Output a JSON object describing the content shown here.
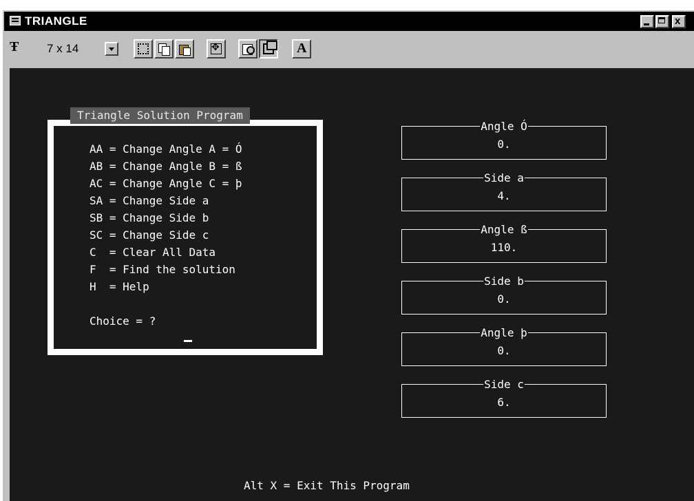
{
  "window": {
    "title": "TRIANGLE",
    "close_label": "x"
  },
  "toolbar": {
    "font_size": "7 x 14",
    "font_icon": "Ŧ",
    "font_button": "A",
    "icons": [
      "font-type-icon",
      "mark-icon",
      "copy-icon",
      "paste-icon",
      "fullscreen-icon",
      "properties-icon",
      "background-icon",
      "font-icon"
    ]
  },
  "menu": {
    "title": "Triangle Solution Program",
    "items": [
      "AA = Change Angle A = Ó",
      "AB = Change Angle B = ß",
      "AC = Change Angle C = þ",
      "SA = Change Side a",
      "SB = Change Side b",
      "SC = Change Side c",
      "C  = Clear All Data",
      "F  = Find the solution",
      "H  = Help"
    ],
    "prompt": "Choice = ?"
  },
  "fields": [
    {
      "label": "Angle Ó",
      "value": "0."
    },
    {
      "label": "Side a",
      "value": "4."
    },
    {
      "label": "Angle ß",
      "value": "110."
    },
    {
      "label": "Side b",
      "value": "0."
    },
    {
      "label": "Angle þ",
      "value": "0."
    },
    {
      "label": "Side c",
      "value": "6."
    }
  ],
  "footer": {
    "exit": "Alt X = Exit This Program"
  },
  "colors": {
    "console_bg": "#1a1a1a",
    "text": "#ffffff",
    "title_bar": "#000000",
    "chrome": "#c0c0c0"
  }
}
